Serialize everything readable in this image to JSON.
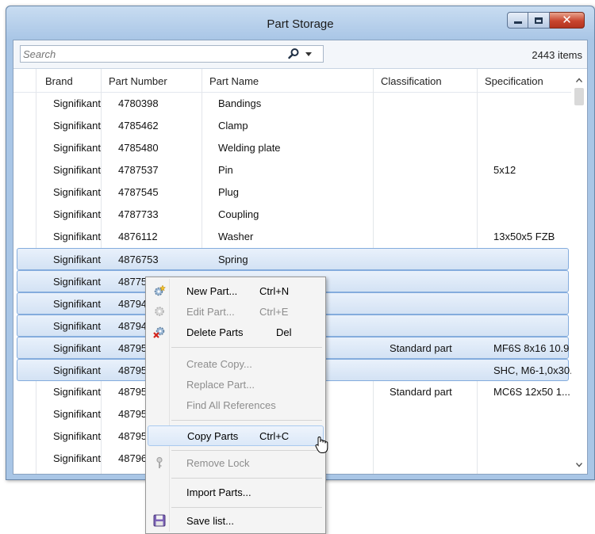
{
  "window": {
    "title": "Part Storage"
  },
  "search": {
    "placeholder": "Search",
    "count": "2443 items"
  },
  "columns": [
    "Brand",
    "Part Number",
    "Part Name",
    "Classification",
    "Specification"
  ],
  "rows": [
    {
      "brand": "Signifikant",
      "number": "4780398",
      "name": "Bandings",
      "class": "",
      "spec": ""
    },
    {
      "brand": "Signifikant",
      "number": "4785462",
      "name": "Clamp",
      "class": "",
      "spec": ""
    },
    {
      "brand": "Signifikant",
      "number": "4785480",
      "name": "Welding plate",
      "class": "",
      "spec": ""
    },
    {
      "brand": "Signifikant",
      "number": "4787537",
      "name": "Pin",
      "class": "",
      "spec": "5x12"
    },
    {
      "brand": "Signifikant",
      "number": "4787545",
      "name": "Plug",
      "class": "",
      "spec": ""
    },
    {
      "brand": "Signifikant",
      "number": "4787733",
      "name": "Coupling",
      "class": "",
      "spec": ""
    },
    {
      "brand": "Signifikant",
      "number": "4876112",
      "name": "Washer",
      "class": "",
      "spec": "13x50x5  FZB"
    },
    {
      "brand": "Signifikant",
      "number": "4876753",
      "name": "Spring",
      "class": "",
      "spec": ""
    },
    {
      "brand": "Signifikant",
      "number": "4877519",
      "name": "",
      "class": "",
      "spec": ""
    },
    {
      "brand": "Signifikant",
      "number": "4879454",
      "name": "",
      "class": "",
      "spec": ""
    },
    {
      "brand": "Signifikant",
      "number": "4879455",
      "name": "",
      "class": "",
      "spec": ""
    },
    {
      "brand": "Signifikant",
      "number": "4879516",
      "name": "",
      "class": "Standard part",
      "spec": "MF6S  8x16  10.9"
    },
    {
      "brand": "Signifikant",
      "number": "4879517",
      "name": "",
      "class": "",
      "spec": "SHC, M6-1,0x30..."
    },
    {
      "brand": "Signifikant",
      "number": "4879527",
      "name": "",
      "class": "Standard part",
      "spec": "MC6S  12x50  1..."
    },
    {
      "brand": "Signifikant",
      "number": "4879531",
      "name": "",
      "class": "",
      "spec": ""
    },
    {
      "brand": "Signifikant",
      "number": "4879535",
      "name": "",
      "class": "",
      "spec": ""
    },
    {
      "brand": "Signifikant",
      "number": "4879631",
      "name": "",
      "class": "",
      "spec": ""
    }
  ],
  "menu": {
    "new_part": "New Part...",
    "new_part_sc": "Ctrl+N",
    "edit_part": "Edit Part...",
    "edit_part_sc": "Ctrl+E",
    "delete_parts": "Delete Parts",
    "delete_parts_sc": "Del",
    "create_copy": "Create Copy...",
    "replace_part": "Replace Part...",
    "find_refs": "Find All References",
    "copy_parts": "Copy Parts",
    "copy_parts_sc": "Ctrl+C",
    "remove_lock": "Remove Lock",
    "import_parts": "Import Parts...",
    "save_list": "Save list..."
  }
}
